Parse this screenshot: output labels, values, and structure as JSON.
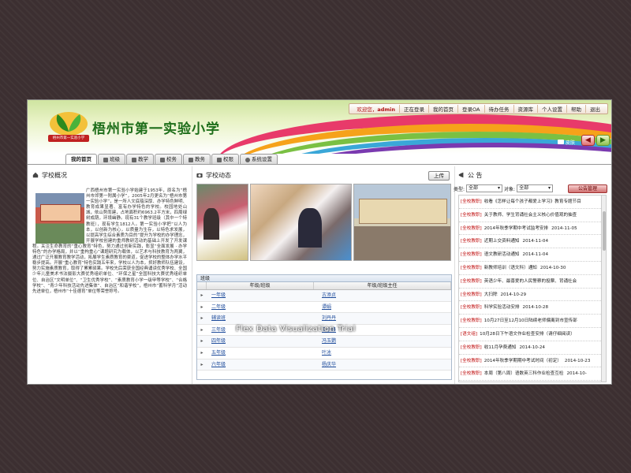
{
  "header": {
    "logo_text": "梧州市第一实验小学",
    "school_name": "梧州市第一实验小学",
    "skin_label": "皮肤",
    "nav": {
      "welcome": "欢迎您，",
      "user": "admin",
      "online": "正在登录",
      "home": "我的首页",
      "oa": "登录OA",
      "todo": "待办任务",
      "resources": "资源库",
      "settings": "个人设置",
      "help": "帮助",
      "exit": "退出"
    }
  },
  "tabs": [
    "我的首页",
    "班级",
    "教学",
    "校务",
    "教务",
    "权限",
    "系统设置"
  ],
  "overview": {
    "title": "学校概况",
    "text": "广西梧州市第一实验小学始建于1953年，原名为“梧州市郊第一附属小学”，2005年2月更名为“梧州市第一实验小学”，是一所人文底蕴深厚、办学特色鲜明、教育成果显著、富有办学特色的学校。校园地处山城，依山势而建，占地面积约6963.2平方米，四周绿树成荫，环境幽静。现有31个教学班级（其中一个特教班），现有学生1812人。第一实验小学把“以人为本，以创新为核心，以质量为生存，以特色求发展，以提高学生综合素质为目的”提升为学校的办学理念，开展学校创建的重师教研活动的基础上开发了开发课程。关注生命教育的“重心教育”特色，努力通过创新实践，彰显“全面发展 · 办学特色”的办学格局，并以“重构重心”课题研究为载体，以艺术与科技教育为两翼，通过广泛开展教育教学活动，拓展学生素质教育的渠道，促进学校的整体办学水平稳步提高。开展“重心教育”特色实践五年来，学校以人为本，抓好教师队伍建设，努力实施素质教育，取得了累累硕果。学校先后荣获全国经典诵读优秀学校、全国少年儿童美术书法摄影大赛优秀组织单位、“环保之星”全国科技大赛优秀组织单位、自治区“文明单位”、“卫生优秀学校”、“素质教育小学一级甲等学校”、“合格学校”、“青少年科技活动先进集体”、自治区“和谐学校”，梧州市“蓄科学月”活动先进单位，梧州市“十佳德育”单位等荣誉称号。"
  },
  "news": {
    "title": "学校动态",
    "upload_label": "上传"
  },
  "grid": {
    "caption": "班级",
    "headers": [
      "年级/班级",
      "年级/班级主任"
    ],
    "rows": [
      {
        "grade": "一年级",
        "teacher": "古添贞"
      },
      {
        "grade": "二年级",
        "teacher": "谭娟"
      },
      {
        "grade": "辅读班",
        "teacher": "刘丹丹"
      },
      {
        "grade": "三年级",
        "teacher": "王小峰"
      },
      {
        "grade": "四年级",
        "teacher": "冯玉鹦"
      },
      {
        "grade": "五年级",
        "teacher": "叶冰"
      },
      {
        "grade": "六年级",
        "teacher": "杨庆华"
      }
    ],
    "watermark": "Flex Data Visualization Trial"
  },
  "announcements": {
    "title": "公 告",
    "type_label": "类型:",
    "type_value": "全部",
    "target_label": "对象:",
    "target_value": "全部",
    "manage_label": "公告管理",
    "items": [
      {
        "tag": "[全校教职]",
        "text": "收看《怎样让每个孩子都爱上学习》教育专题节目",
        "date": ""
      },
      {
        "tag": "[全校教职]",
        "text": "关于教师、学生背诵社会主义核心价值观的抽查",
        "date": ""
      },
      {
        "tag": "[全校教职]",
        "text": "2014年秋季学期中考试监考安排",
        "date": "2014-11-05"
      },
      {
        "tag": "[全校教职]",
        "text": "近期上交资料通知",
        "date": "2014-11-04"
      },
      {
        "tag": "[全校教职]",
        "text": "语文教研活动通知",
        "date": "2014-11-04"
      },
      {
        "tag": "[全校教职]",
        "text": "新教师培训（语文科）通知",
        "date": "2014-10-30"
      },
      {
        "tag": "[全校教职]",
        "text": "英语少年、最喜爱的人民警察的投票、背诵社会",
        "date": ""
      },
      {
        "tag": "[全校教职]",
        "text": "大扫除",
        "date": "2014-10-29"
      },
      {
        "tag": "[全校教职]",
        "text": "科学实验活动安排",
        "date": "2014-10-28"
      },
      {
        "tag": "[全校教职]",
        "text": "10月27日至12月10日陆续老师偏离到市宣传部",
        "date": ""
      },
      {
        "tag": "[语文组]",
        "text": "10月28日下午语文作业检查安排（请仔细阅读）",
        "date": ""
      },
      {
        "tag": "[全校教职]",
        "text": "收11月孕费通知",
        "date": "2014-10-24"
      },
      {
        "tag": "[全校教职]",
        "text": "2014年秋季学期期中考试时间（初定）",
        "date": "2014-10-23"
      },
      {
        "tag": "[全校教职]",
        "text": "本周（第八周）语数英三科作业检查互检",
        "date": "2014-10-"
      }
    ]
  },
  "colors": {
    "brand_green": "#1e6e1a",
    "accent_red": "#c01010"
  }
}
